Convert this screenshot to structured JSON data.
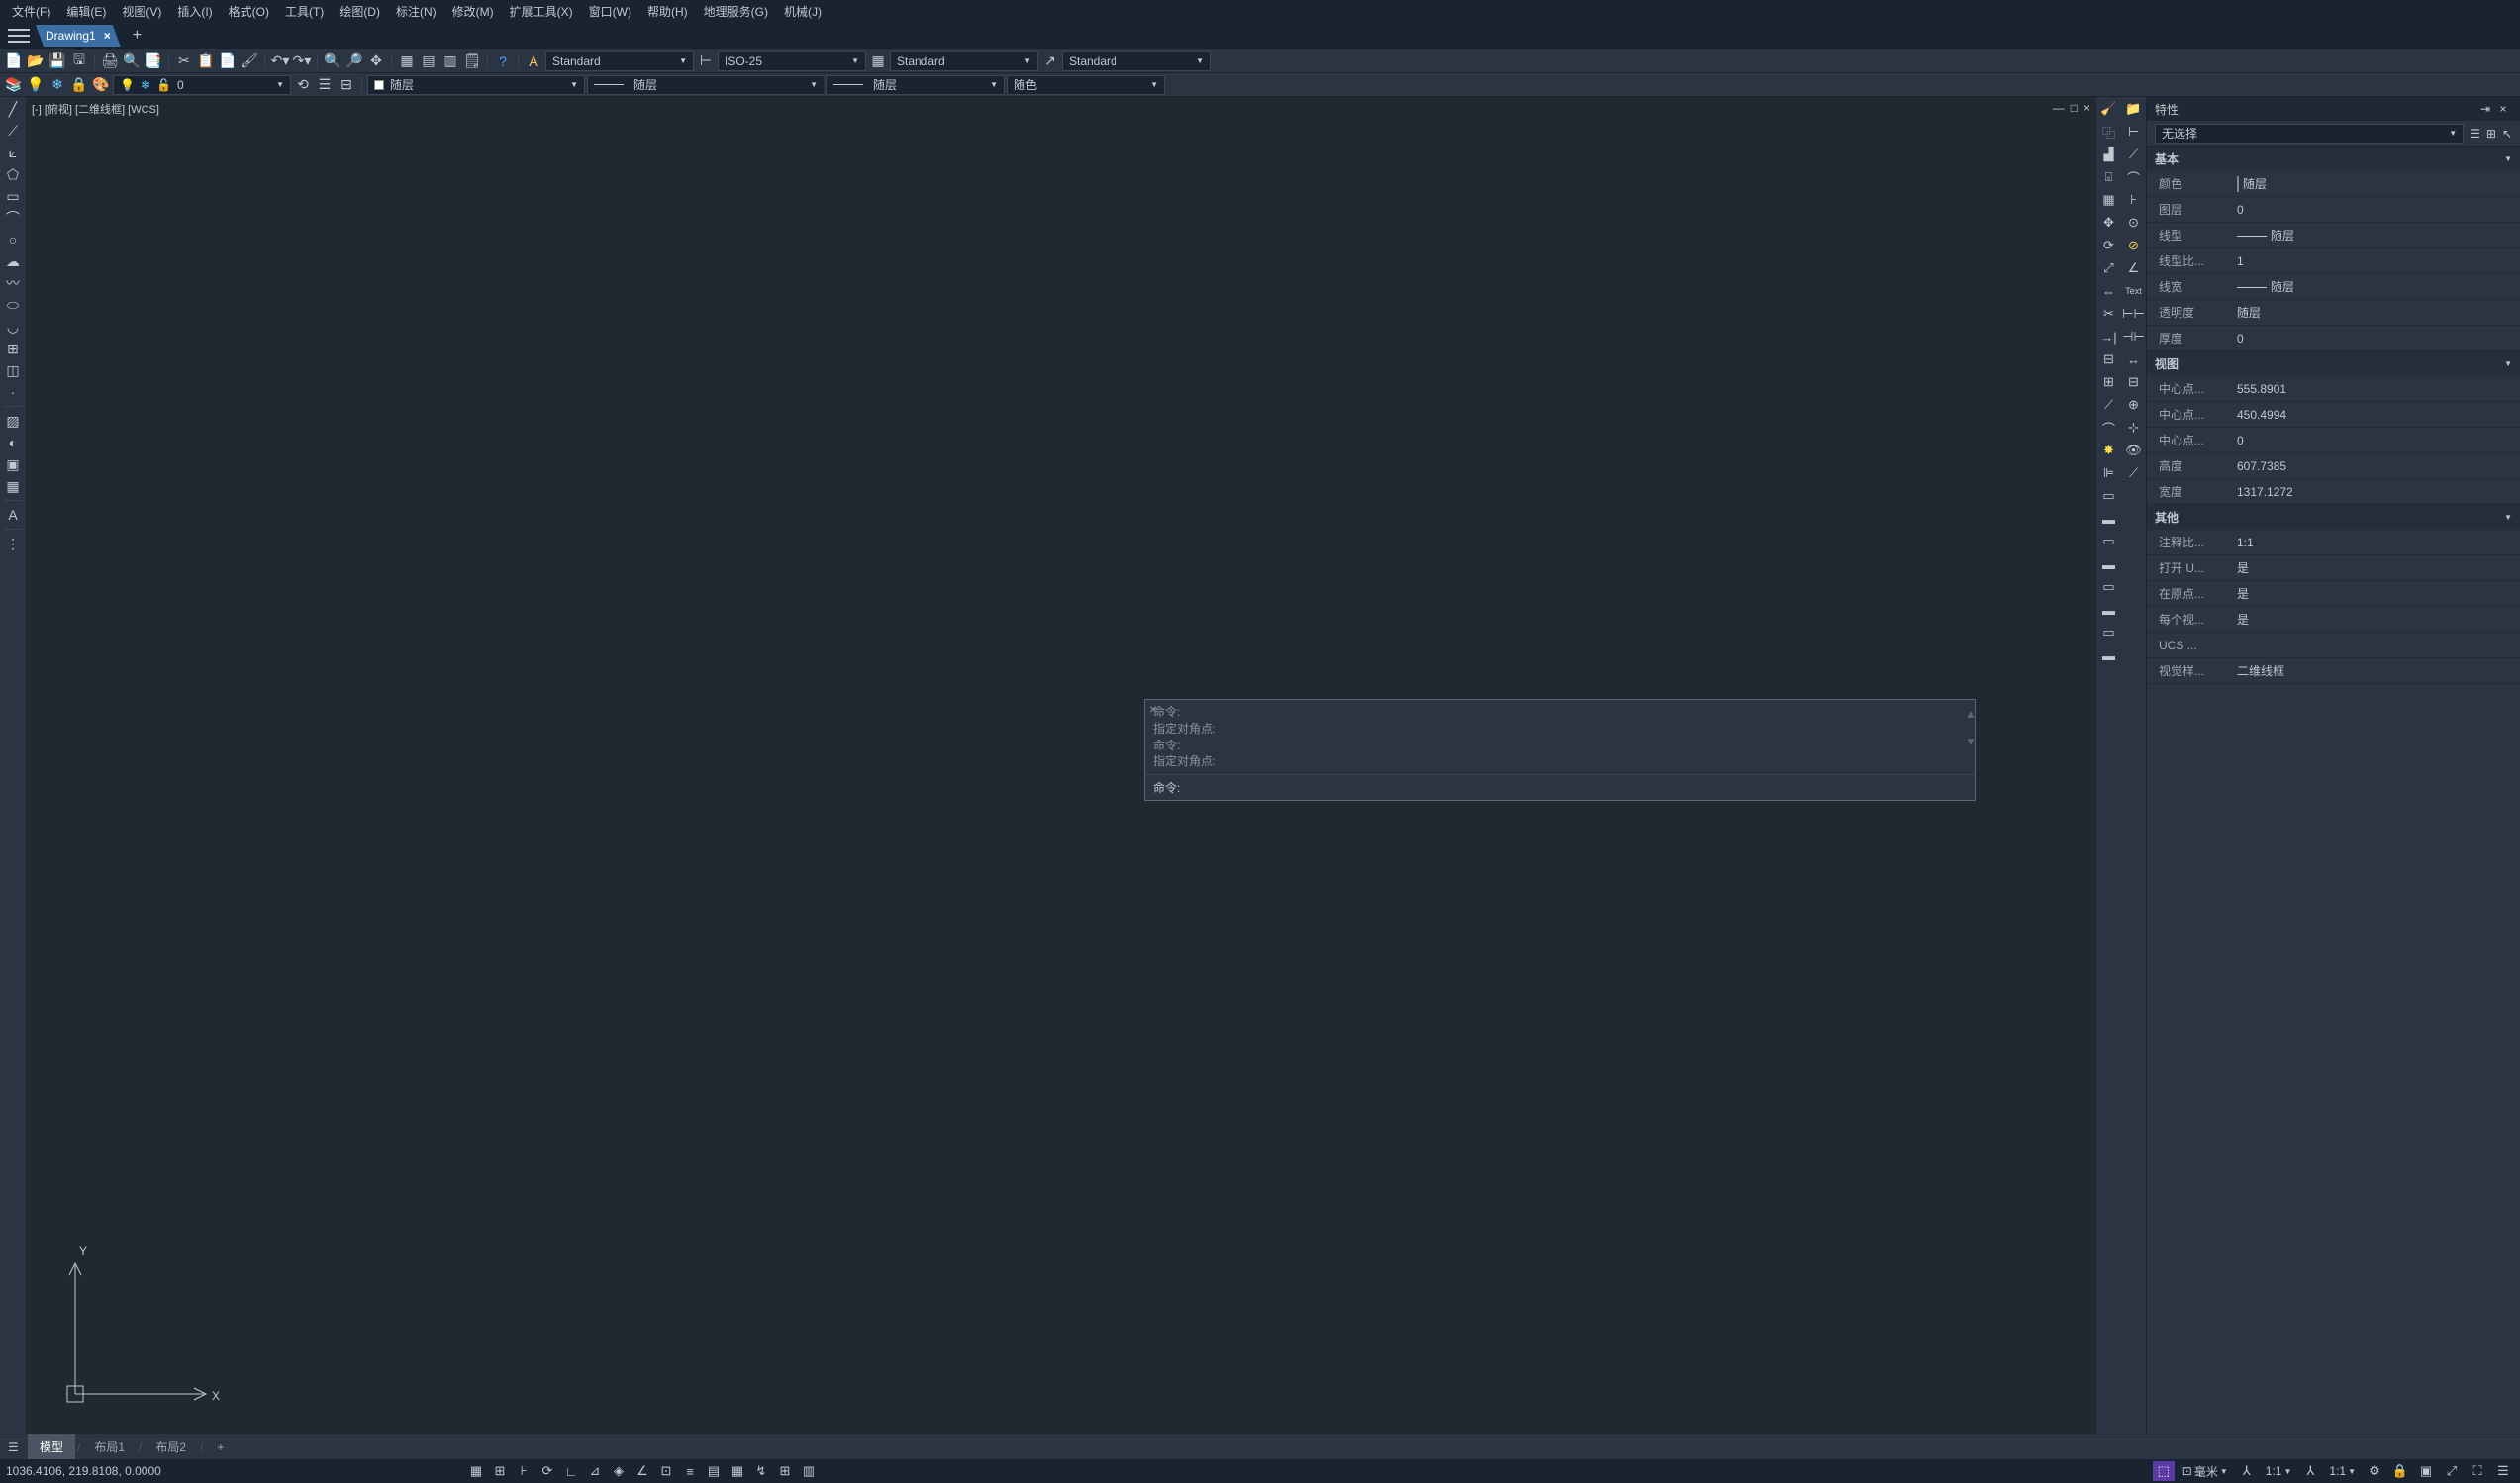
{
  "menu": [
    "文件(F)",
    "编辑(E)",
    "视图(V)",
    "插入(I)",
    "格式(O)",
    "工具(T)",
    "绘图(D)",
    "标注(N)",
    "修改(M)",
    "扩展工具(X)",
    "窗口(W)",
    "帮助(H)",
    "地理服务(G)",
    "机械(J)"
  ],
  "tab": {
    "name": "Drawing1"
  },
  "toolbar1": {
    "text_style": "Standard",
    "dim_style": "ISO-25",
    "table_style": "Standard",
    "mleader_style": "Standard"
  },
  "toolbar2": {
    "layer": "0",
    "color": "随层",
    "linetype": "随层",
    "lineweight": "随层",
    "plotstyle": "随色"
  },
  "viewport": {
    "label": "[-] [俯视] [二维线框] [WCS]",
    "axis_y": "Y",
    "axis_x": "X"
  },
  "cmd": {
    "history": [
      "命令:",
      "指定对角点:",
      "命令:",
      "指定对角点:"
    ],
    "prompt": "命令:"
  },
  "properties": {
    "title": "特性",
    "selector": "无选择",
    "sections": {
      "basic": {
        "title": "基本",
        "rows": [
          {
            "label": "颜色",
            "value": "随层",
            "swatch": true
          },
          {
            "label": "图层",
            "value": "0"
          },
          {
            "label": "线型",
            "value": "随层",
            "line": true
          },
          {
            "label": "线型比...",
            "value": "1"
          },
          {
            "label": "线宽",
            "value": "随层",
            "line": true
          },
          {
            "label": "透明度",
            "value": "随层"
          },
          {
            "label": "厚度",
            "value": "0"
          }
        ]
      },
      "view": {
        "title": "视图",
        "rows": [
          {
            "label": "中心点...",
            "value": "555.8901"
          },
          {
            "label": "中心点...",
            "value": "450.4994"
          },
          {
            "label": "中心点...",
            "value": "0"
          },
          {
            "label": "高度",
            "value": "607.7385"
          },
          {
            "label": "宽度",
            "value": "1317.1272"
          }
        ]
      },
      "other": {
        "title": "其他",
        "rows": [
          {
            "label": "注释比...",
            "value": "1:1"
          },
          {
            "label": "打开 U...",
            "value": "是"
          },
          {
            "label": "在原点...",
            "value": "是"
          },
          {
            "label": "每个视...",
            "value": "是"
          },
          {
            "label": "UCS ...",
            "value": ""
          },
          {
            "label": "视觉样...",
            "value": "二维线框"
          }
        ]
      }
    }
  },
  "bottom_tabs": {
    "model": "模型",
    "layout1": "布局1",
    "layout2": "布局2"
  },
  "status": {
    "coords": "1036.4106, 219.8108, 0.0000",
    "unit": "毫米",
    "scale1": "1:1",
    "scale2": "1:1"
  }
}
